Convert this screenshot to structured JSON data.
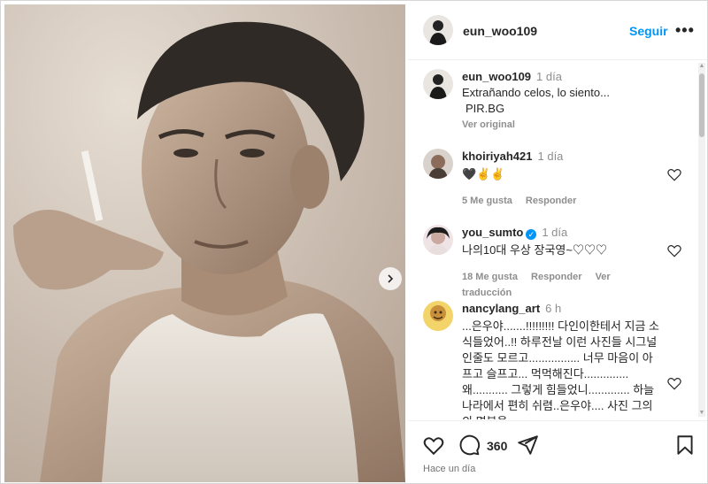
{
  "post": {
    "username": "eun_woo109",
    "follow_label": "Seguir",
    "more_label": "•••",
    "caption": {
      "username": "eun_woo109",
      "time": "1 día",
      "text": "Extrañando celos, lo siento...",
      "source": "PIR.BG",
      "see_original": "Ver original"
    }
  },
  "comments": [
    {
      "username": "khoiriyah421",
      "time": "1 día",
      "text": "🖤✌️✌️",
      "likes": "5 Me gusta",
      "reply": "Responder"
    },
    {
      "username": "you_sumto",
      "verified": "✓",
      "time": "1 día",
      "text": "나의10대 우상 장국영~♡♡♡",
      "likes": "18 Me gusta",
      "reply": "Responder",
      "translate": "Ver traducción"
    },
    {
      "username": "nancylang_art",
      "time": "6 h",
      "text": "...은우야.......!!!!!!!!! 다인이한테서 지금 소식들었어..!! 하루전날 이런 사진들 시그널인줄도 모르고................ 너무 마음이 아프고 슬프고... 먹먹해진다.............. 왜........... 그렇게 힘들었니............. 하늘나라에서 편히 쉬렴..은우야.... 사진 그의의 명복을"
    }
  ],
  "footer": {
    "comment_count": "360",
    "posted_ago": "Hace un día"
  },
  "icons": {
    "carousel_next": "chevron-right-icon",
    "like": "heart-icon",
    "comment": "comment-icon",
    "share": "send-icon",
    "save": "bookmark-icon"
  },
  "colors": {
    "follow": "#0095f6",
    "verified": "#0095f6",
    "muted": "#8e8e8e"
  }
}
